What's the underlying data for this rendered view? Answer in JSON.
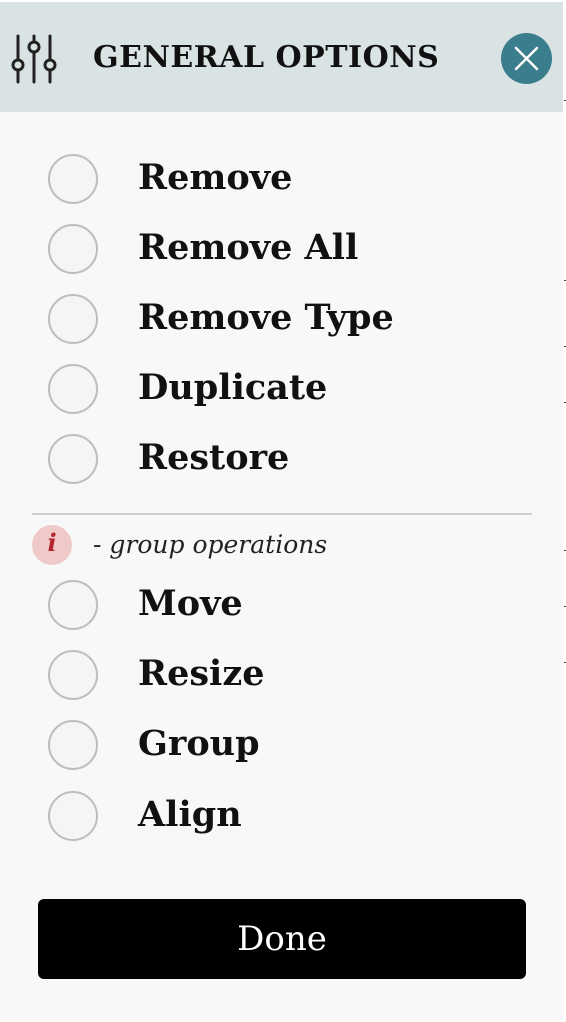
{
  "header": {
    "title": "GENERAL OPTIONS",
    "settings_icon": "sliders-icon",
    "close_icon": "close-icon",
    "close_color": "#3a7d8c",
    "background": "#d9e3e3"
  },
  "options": [
    {
      "label": "Remove",
      "selected": false
    },
    {
      "label": "Remove All",
      "selected": false
    },
    {
      "label": "Remove Type",
      "selected": false
    },
    {
      "label": "Duplicate",
      "selected": false
    },
    {
      "label": "Restore",
      "selected": false
    }
  ],
  "group_info": {
    "icon": "info-icon",
    "icon_text": "i",
    "text": "- group operations",
    "icon_color": "#b3262e"
  },
  "group_options": [
    {
      "label": "Move",
      "selected": false
    },
    {
      "label": "Resize",
      "selected": false
    },
    {
      "label": "Group",
      "selected": false
    },
    {
      "label": "Align",
      "selected": false
    }
  ],
  "footer": {
    "done_label": "Done"
  }
}
